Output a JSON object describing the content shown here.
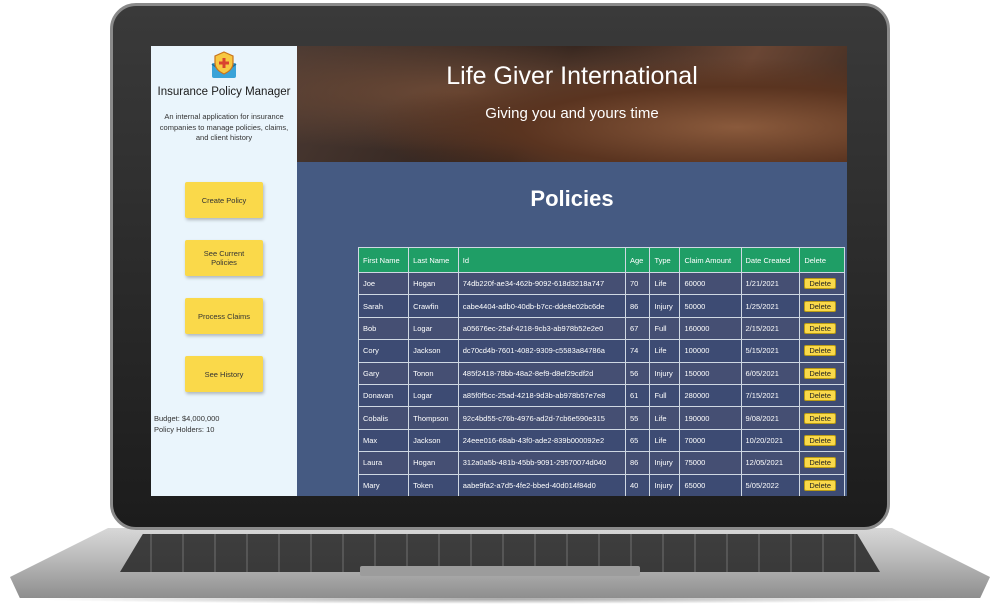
{
  "sidebar": {
    "app_title": "Insurance Policy Manager",
    "description": "An internal application for insurance companies to manage policies, claims, and client history",
    "nav": [
      "Create Policy",
      "See Current Policies",
      "Process Claims",
      "See History"
    ],
    "budget": "Budget: $4,000,000",
    "policy_holders": "Policy Holders: 10"
  },
  "header": {
    "title": "Life Giver International",
    "subtitle": "Giving you and yours time"
  },
  "main": {
    "section_title": "Policies",
    "columns": [
      "First Name",
      "Last Name",
      "Id",
      "Age",
      "Type",
      "Claim Amount",
      "Date Created",
      "Delete"
    ],
    "delete_label": "Delete",
    "rows": [
      [
        "Joe",
        "Hogan",
        "74db220f-ae34-462b-9092-618d3218a747",
        "70",
        "Life",
        "60000",
        "1/21/2021"
      ],
      [
        "Sarah",
        "Crawfin",
        "cabe4404-adb0-40db-b7cc-dde8e02bc6de",
        "86",
        "Injury",
        "50000",
        "1/25/2021"
      ],
      [
        "Bob",
        "Logar",
        "a05676ec-25af-4218-9cb3-ab978b52e2e0",
        "67",
        "Full",
        "160000",
        "2/15/2021"
      ],
      [
        "Cory",
        "Jackson",
        "dc70cd4b-7601-4082-9309-c5583a84786a",
        "74",
        "Life",
        "100000",
        "5/15/2021"
      ],
      [
        "Gary",
        "Tonon",
        "485f2418-78bb-48a2-8ef9-d8ef29cdf2d",
        "56",
        "Injury",
        "150000",
        "6/05/2021"
      ],
      [
        "Donavan",
        "Logar",
        "a85f0f5cc-25ad-4218-9d3b-ab978b57e7e8",
        "61",
        "Full",
        "280000",
        "7/15/2021"
      ],
      [
        "Cobalis",
        "Thompson",
        "92c4bd55-c76b-4976-ad2d-7cb6e590e315",
        "55",
        "Life",
        "190000",
        "9/08/2021"
      ],
      [
        "Max",
        "Jackson",
        "24eee016-68ab-43f0-ade2-839b000092e2",
        "65",
        "Life",
        "70000",
        "10/20/2021"
      ],
      [
        "Laura",
        "Hogan",
        "312a0a5b-481b-45bb-9091-29570074d040",
        "86",
        "Injury",
        "75000",
        "12/05/2021"
      ],
      [
        "Mary",
        "Token",
        "aabe9fa2-a7d5-4fe2-bbed-40d014f84d0",
        "40",
        "Injury",
        "65000",
        "5/05/2022"
      ]
    ]
  },
  "colors": {
    "sidebar_bg": "#eaf5fc",
    "main_bg": "#455a82",
    "table_header": "#1f9e66",
    "button": "#fad94a"
  }
}
